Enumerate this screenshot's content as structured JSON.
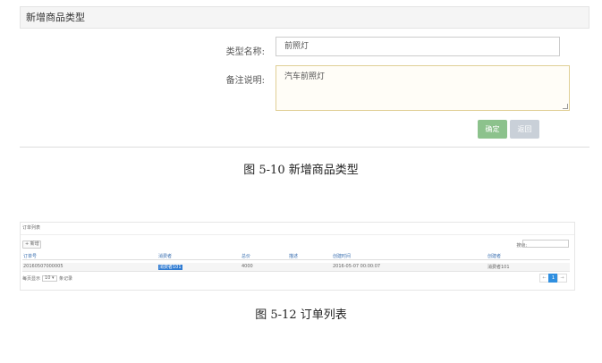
{
  "form_panel": {
    "title": "新增商品类型",
    "type_name_label": "类型名称:",
    "type_name_value": "前照灯",
    "remark_label": "备注说明:",
    "remark_value": "汽车前照灯",
    "confirm_label": "确定",
    "back_label": "返回"
  },
  "caption_1": "图 5-10 新增商品类型",
  "order_panel": {
    "title": "订单列表",
    "add_label": "+ 新增",
    "search_label": "搜索:",
    "columns": [
      "订单号",
      "消费者",
      "总价",
      "描述",
      "创建时间",
      "创建者"
    ],
    "rows": [
      [
        "20160507000005",
        "消费者101",
        "4000",
        "",
        "2016-05-07 00:00:07",
        "消费者101"
      ]
    ],
    "length_prefix": "每页显示",
    "length_value": "10",
    "length_suffix": "条记录",
    "pager": [
      "←",
      "1",
      "→"
    ]
  },
  "caption_2": "图 5-12 订单列表"
}
